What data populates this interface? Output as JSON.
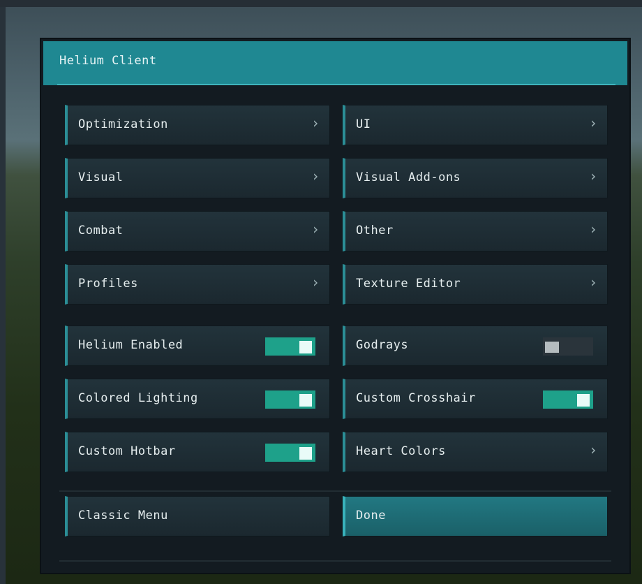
{
  "window": {
    "title": "Helium Client"
  },
  "categories": [
    {
      "label": "Optimization",
      "icon": "chevron-right-icon"
    },
    {
      "label": "UI",
      "icon": "chevron-right-icon"
    },
    {
      "label": "Visual",
      "icon": "chevron-right-icon"
    },
    {
      "label": "Visual Add-ons",
      "icon": "chevron-right-icon"
    },
    {
      "label": "Combat",
      "icon": "chevron-right-icon"
    },
    {
      "label": "Other",
      "icon": "chevron-right-icon"
    },
    {
      "label": "Profiles",
      "icon": "chevron-right-icon"
    },
    {
      "label": "Texture Editor",
      "icon": "chevron-right-icon"
    }
  ],
  "toggles": [
    {
      "label": "Helium Enabled",
      "on": true
    },
    {
      "label": "Godrays",
      "on": false
    },
    {
      "label": "Colored Lighting",
      "on": true
    },
    {
      "label": "Custom Crosshair",
      "on": true
    },
    {
      "label": "Custom Hotbar",
      "on": true
    },
    {
      "label": "Heart Colors",
      "icon": "chevron-right-icon"
    }
  ],
  "footer": {
    "classic_menu": "Classic Menu",
    "done": "Done"
  },
  "chevron_glyph": "›",
  "colors": {
    "accent": "#2b8e96",
    "header": "#1f8892",
    "toggle_on": "#1ea18a",
    "toggle_off": "#2a343b",
    "panel": "#131b21"
  }
}
